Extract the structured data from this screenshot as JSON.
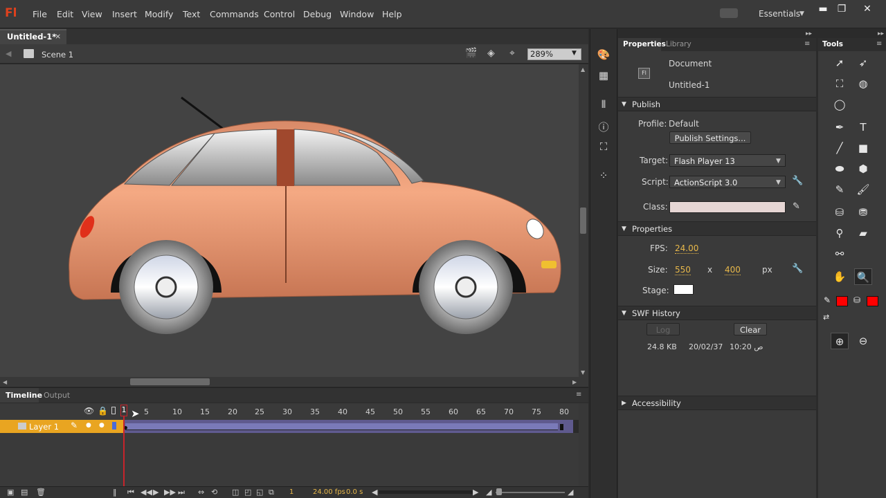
{
  "app": {
    "logo": "Fl"
  },
  "menu": [
    "File",
    "Edit",
    "View",
    "Insert",
    "Modify",
    "Text",
    "Commands",
    "Control",
    "Debug",
    "Window",
    "Help"
  ],
  "workspace": {
    "label": "Essentials"
  },
  "window_buttons": {
    "minimize": "▬",
    "restore": "❐",
    "close": "✕"
  },
  "document_tab": {
    "label": "Untitled-1*",
    "close": "×"
  },
  "editbar": {
    "scene": "Scene 1",
    "zoom": "289%"
  },
  "timeline": {
    "tab": "Timeline",
    "output_tab": "Output",
    "ruler": [
      "1",
      "5",
      "10",
      "15",
      "20",
      "25",
      "30",
      "35",
      "40",
      "45",
      "50",
      "55",
      "60",
      "65",
      "70",
      "75",
      "80"
    ],
    "layer": "Layer 1",
    "current_frame": "1",
    "fps": "24.00 fps",
    "time": "0.0 s"
  },
  "properties": {
    "tab": "Properties",
    "library_tab": "Library",
    "doc_type": "Document",
    "doc_name": "Untitled-1",
    "publish_section": "Publish",
    "profile_label": "Profile:",
    "profile_value": "Default",
    "publish_settings": "Publish Settings...",
    "target_label": "Target:",
    "target_value": "Flash Player 13",
    "script_label": "Script:",
    "script_value": "ActionScript 3.0",
    "class_label": "Class:",
    "properties_section": "Properties",
    "fps_label": "FPS:",
    "fps_value": "24.00",
    "size_label": "Size:",
    "width": "550",
    "x": "x",
    "height": "400",
    "px": "px",
    "stage_label": "Stage:",
    "swf_section": "SWF History",
    "log_button": "Log",
    "clear_button": "Clear",
    "swf_size": "24.8 KB",
    "swf_date": "20/02/37",
    "swf_time": "10:20 ص",
    "accessibility_section": "Accessibility"
  },
  "tools": {
    "title": "Tools"
  },
  "colors": {
    "stroke": "#ff0000",
    "fill": "#ff0000",
    "stage": "#ffffff",
    "layer": "#e9a521",
    "playhead": "#c8242b"
  }
}
